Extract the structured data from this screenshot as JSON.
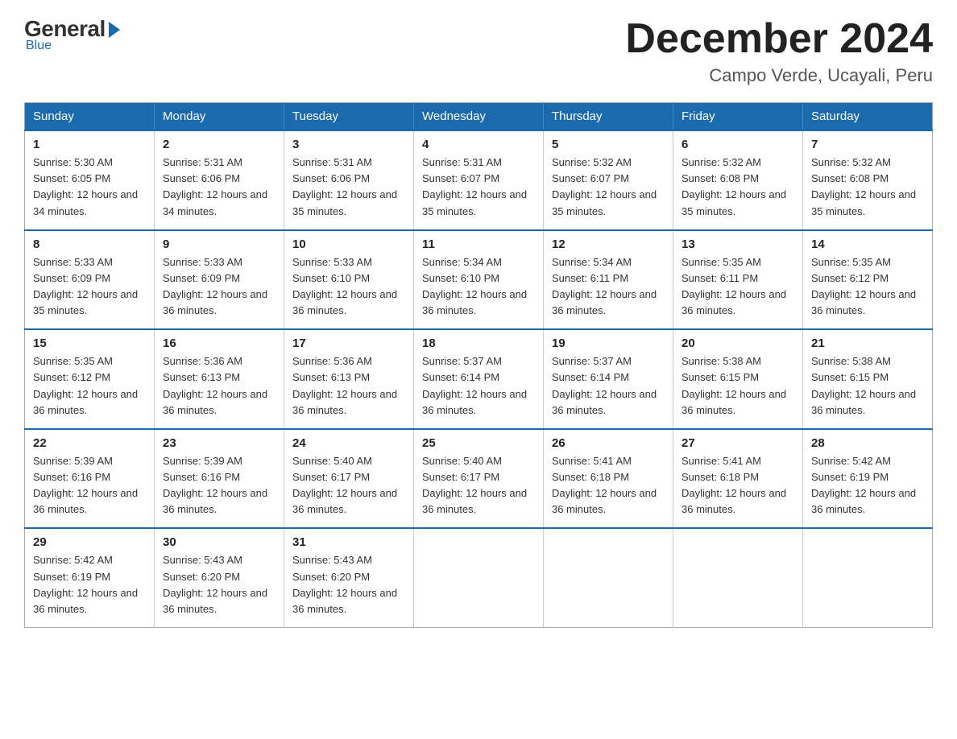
{
  "logo": {
    "general": "General",
    "blue": "Blue",
    "subtitle": "Blue"
  },
  "header": {
    "month": "December 2024",
    "location": "Campo Verde, Ucayali, Peru"
  },
  "days_of_week": [
    "Sunday",
    "Monday",
    "Tuesday",
    "Wednesday",
    "Thursday",
    "Friday",
    "Saturday"
  ],
  "weeks": [
    [
      {
        "day": "1",
        "sunrise": "5:30 AM",
        "sunset": "6:05 PM",
        "daylight": "12 hours and 34 minutes."
      },
      {
        "day": "2",
        "sunrise": "5:31 AM",
        "sunset": "6:06 PM",
        "daylight": "12 hours and 34 minutes."
      },
      {
        "day": "3",
        "sunrise": "5:31 AM",
        "sunset": "6:06 PM",
        "daylight": "12 hours and 35 minutes."
      },
      {
        "day": "4",
        "sunrise": "5:31 AM",
        "sunset": "6:07 PM",
        "daylight": "12 hours and 35 minutes."
      },
      {
        "day": "5",
        "sunrise": "5:32 AM",
        "sunset": "6:07 PM",
        "daylight": "12 hours and 35 minutes."
      },
      {
        "day": "6",
        "sunrise": "5:32 AM",
        "sunset": "6:08 PM",
        "daylight": "12 hours and 35 minutes."
      },
      {
        "day": "7",
        "sunrise": "5:32 AM",
        "sunset": "6:08 PM",
        "daylight": "12 hours and 35 minutes."
      }
    ],
    [
      {
        "day": "8",
        "sunrise": "5:33 AM",
        "sunset": "6:09 PM",
        "daylight": "12 hours and 35 minutes."
      },
      {
        "day": "9",
        "sunrise": "5:33 AM",
        "sunset": "6:09 PM",
        "daylight": "12 hours and 36 minutes."
      },
      {
        "day": "10",
        "sunrise": "5:33 AM",
        "sunset": "6:10 PM",
        "daylight": "12 hours and 36 minutes."
      },
      {
        "day": "11",
        "sunrise": "5:34 AM",
        "sunset": "6:10 PM",
        "daylight": "12 hours and 36 minutes."
      },
      {
        "day": "12",
        "sunrise": "5:34 AM",
        "sunset": "6:11 PM",
        "daylight": "12 hours and 36 minutes."
      },
      {
        "day": "13",
        "sunrise": "5:35 AM",
        "sunset": "6:11 PM",
        "daylight": "12 hours and 36 minutes."
      },
      {
        "day": "14",
        "sunrise": "5:35 AM",
        "sunset": "6:12 PM",
        "daylight": "12 hours and 36 minutes."
      }
    ],
    [
      {
        "day": "15",
        "sunrise": "5:35 AM",
        "sunset": "6:12 PM",
        "daylight": "12 hours and 36 minutes."
      },
      {
        "day": "16",
        "sunrise": "5:36 AM",
        "sunset": "6:13 PM",
        "daylight": "12 hours and 36 minutes."
      },
      {
        "day": "17",
        "sunrise": "5:36 AM",
        "sunset": "6:13 PM",
        "daylight": "12 hours and 36 minutes."
      },
      {
        "day": "18",
        "sunrise": "5:37 AM",
        "sunset": "6:14 PM",
        "daylight": "12 hours and 36 minutes."
      },
      {
        "day": "19",
        "sunrise": "5:37 AM",
        "sunset": "6:14 PM",
        "daylight": "12 hours and 36 minutes."
      },
      {
        "day": "20",
        "sunrise": "5:38 AM",
        "sunset": "6:15 PM",
        "daylight": "12 hours and 36 minutes."
      },
      {
        "day": "21",
        "sunrise": "5:38 AM",
        "sunset": "6:15 PM",
        "daylight": "12 hours and 36 minutes."
      }
    ],
    [
      {
        "day": "22",
        "sunrise": "5:39 AM",
        "sunset": "6:16 PM",
        "daylight": "12 hours and 36 minutes."
      },
      {
        "day": "23",
        "sunrise": "5:39 AM",
        "sunset": "6:16 PM",
        "daylight": "12 hours and 36 minutes."
      },
      {
        "day": "24",
        "sunrise": "5:40 AM",
        "sunset": "6:17 PM",
        "daylight": "12 hours and 36 minutes."
      },
      {
        "day": "25",
        "sunrise": "5:40 AM",
        "sunset": "6:17 PM",
        "daylight": "12 hours and 36 minutes."
      },
      {
        "day": "26",
        "sunrise": "5:41 AM",
        "sunset": "6:18 PM",
        "daylight": "12 hours and 36 minutes."
      },
      {
        "day": "27",
        "sunrise": "5:41 AM",
        "sunset": "6:18 PM",
        "daylight": "12 hours and 36 minutes."
      },
      {
        "day": "28",
        "sunrise": "5:42 AM",
        "sunset": "6:19 PM",
        "daylight": "12 hours and 36 minutes."
      }
    ],
    [
      {
        "day": "29",
        "sunrise": "5:42 AM",
        "sunset": "6:19 PM",
        "daylight": "12 hours and 36 minutes."
      },
      {
        "day": "30",
        "sunrise": "5:43 AM",
        "sunset": "6:20 PM",
        "daylight": "12 hours and 36 minutes."
      },
      {
        "day": "31",
        "sunrise": "5:43 AM",
        "sunset": "6:20 PM",
        "daylight": "12 hours and 36 minutes."
      },
      null,
      null,
      null,
      null
    ]
  ]
}
